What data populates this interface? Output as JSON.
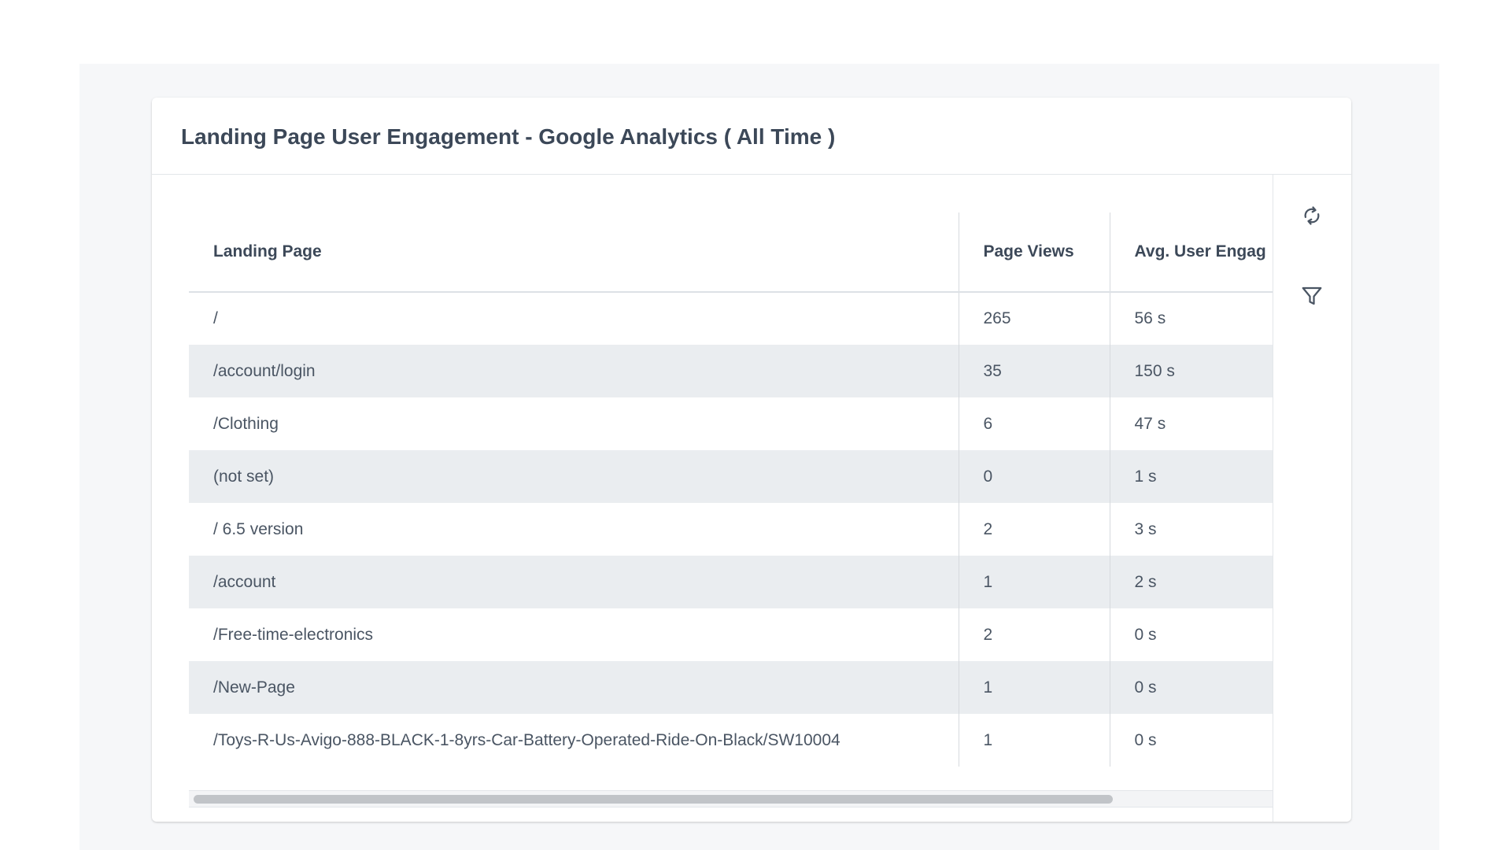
{
  "widget": {
    "title": "Landing Page User Engagement - Google Analytics ( All Time )"
  },
  "table": {
    "columns": [
      "Landing Page",
      "Page Views",
      "Avg. User Engag"
    ],
    "rows": [
      [
        "/",
        "265",
        "56 s"
      ],
      [
        "/account/login",
        "35",
        "150 s"
      ],
      [
        "/Clothing",
        "6",
        "47 s"
      ],
      [
        "(not set)",
        "0",
        "1 s"
      ],
      [
        "/ 6.5 version",
        "2",
        "3 s"
      ],
      [
        "/account",
        "1",
        "2 s"
      ],
      [
        "/Free-time-electronics",
        "2",
        "0 s"
      ],
      [
        "/New-Page",
        "1",
        "0 s"
      ],
      [
        "/Toys-R-Us-Avigo-888-BLACK-1-8yrs-Car-Battery-Operated-Ride-On-Black/SW10004",
        "1",
        "0 s"
      ]
    ]
  },
  "toolbar": {
    "refresh_icon": "refresh-icon",
    "filter_icon": "filter-icon"
  },
  "colors": {
    "text": "#3c4858",
    "row_stripe": "#eaedf0",
    "background": "#f6f7f9",
    "icon": "#4a5563"
  }
}
